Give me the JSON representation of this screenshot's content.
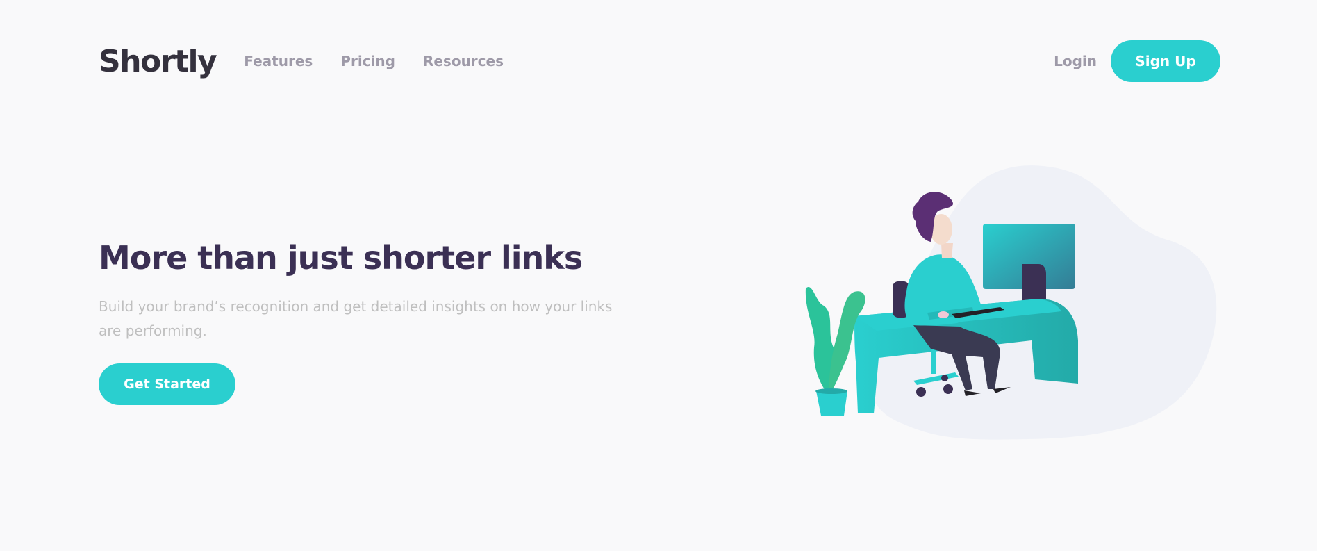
{
  "brand": {
    "logo": "Shortly",
    "accent": "#2acfcf",
    "heading_color": "#3b3054"
  },
  "nav": {
    "items": [
      {
        "label": "Features"
      },
      {
        "label": "Pricing"
      },
      {
        "label": "Resources"
      }
    ],
    "login": "Login",
    "signup": "Sign Up"
  },
  "hero": {
    "title": "More than just shorter links",
    "subtitle": "Build your brand’s recognition and get detailed insights on how your links are performing.",
    "cta": "Get Started",
    "illustration": "person-working-at-desk-illustration"
  }
}
